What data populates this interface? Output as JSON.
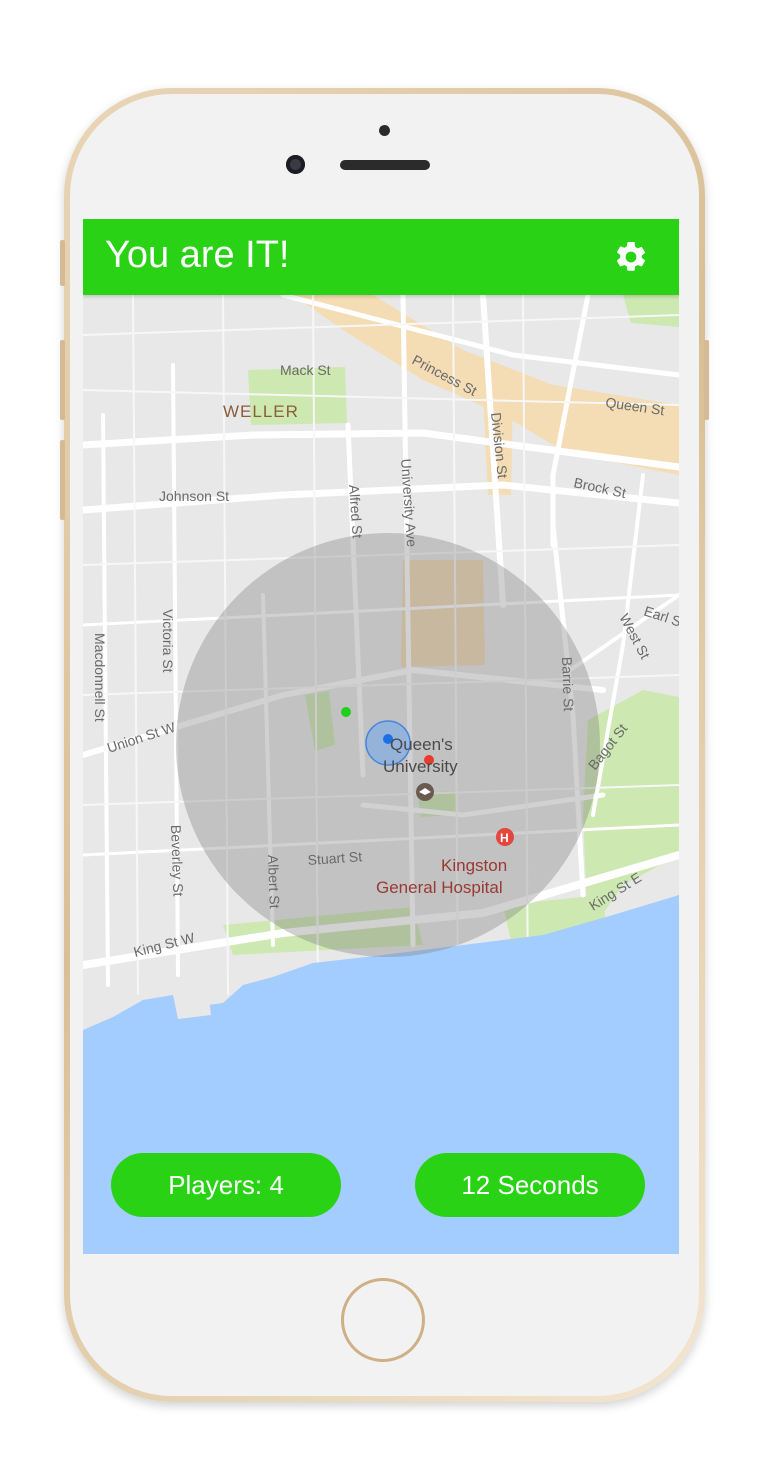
{
  "app_bar": {
    "title": "You are IT!",
    "settings_icon": "gear-icon"
  },
  "map": {
    "street_labels": {
      "mack": "Mack St",
      "princess": "Princess St",
      "queen": "Queen St",
      "division": "Division St",
      "johnson": "Johnson St",
      "brock": "Brock St",
      "alfred": "Alfred St",
      "university": "University Ave",
      "earl": "Earl St",
      "west": "West St",
      "victoria": "Victoria St",
      "macdonnell": "Macdonnell St",
      "union": "Union St W",
      "barrie": "Barrie St",
      "bagot": "Bagot St",
      "beverley": "Beverley St",
      "albert": "Albert St",
      "stuart": "Stuart St",
      "king_e": "King St E",
      "king_w": "King St W"
    },
    "district_label": "WELLER",
    "poi": {
      "university_line1": "Queen's",
      "university_line2": "University",
      "hospital_line1": "Kingston",
      "hospital_line2": "General Hospital",
      "hospital_icon_glyph": "H"
    },
    "colors": {
      "land": "#e8e8e8",
      "water": "#a3ccff",
      "park": "#cde8b0",
      "commercial": "#f4dcb4",
      "radius": "#7c7c7c"
    }
  },
  "footer": {
    "players_label": "Players: 4",
    "timer_label": "12 Seconds"
  },
  "accent_color": "#2ad216"
}
